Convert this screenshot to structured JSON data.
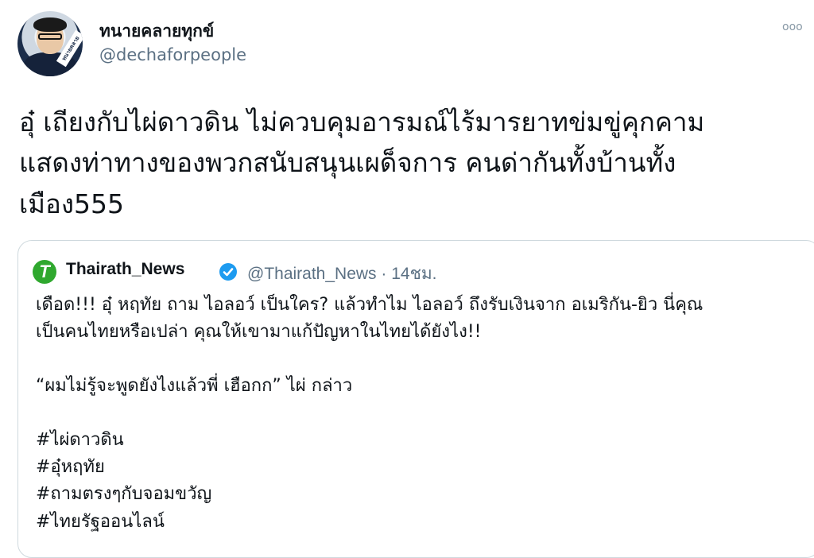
{
  "author": {
    "display_name": "ทนายคลายทุกข์",
    "handle": "@dechaforpeople",
    "avatar_banner_text": "ทนายคลายทุกข์"
  },
  "tweet": {
    "lines": [
      "อุ๋ เถียงกับไผ่ดาวดิน ไม่ควบคุมอารมณ์ไร้มารยาทข่มขู่คุกคาม",
      "แสดงท่าทางของพวกสนับสนุนเผด็จการ คนด่ากันทั้งบ้านทั้ง",
      "เมือง555"
    ]
  },
  "more_label": "ooo",
  "quoted": {
    "logo_letter": "T",
    "name": "Thairath_News",
    "handle_time": "@Thairath_News · 14ชม.",
    "body_lines": [
      "เดือด!!! อุ๋ หฤทัย ถาม ไอลอว์ เป็นใคร? แล้วทำไม ไอลอว์ ถึงรับเงินจาก อเมริกัน-ยิว นี่คุณ",
      "เป็นคนไทยหรือเปล่า คุณให้เขามาแก้ปัญหาในไทยได้ยังไง!!"
    ],
    "quote_line": "“ผมไม่รู้จะพูดยังไงแล้วพี่ เฮือกก” ไผ่ กล่าว",
    "hashtags": [
      "#ไผ่ดาวดิน",
      "#อุ๋หฤทัย",
      "#ถามตรงๆกับจอมขวัญ",
      "#ไทยรัฐออนไลน์"
    ]
  },
  "colors": {
    "text": "#0f1419",
    "secondary": "#5b7083",
    "verified": "#1d9bf0",
    "thairath_green": "#2fa82e",
    "border": "#cfd9de"
  }
}
